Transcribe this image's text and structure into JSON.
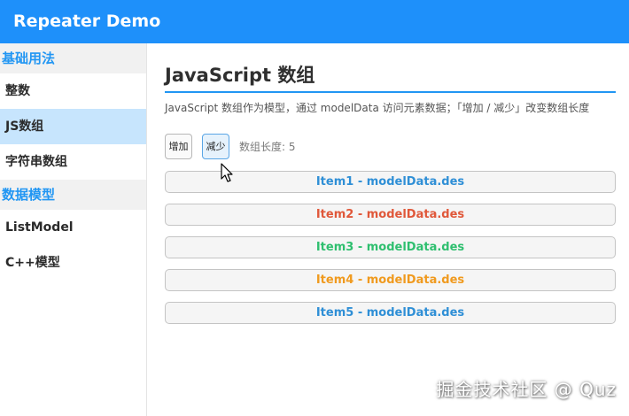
{
  "app": {
    "title": "Repeater Demo"
  },
  "sidebar": {
    "groups": [
      {
        "header": "基础用法",
        "items": [
          "整数",
          "JS数组",
          "字符串数组"
        ]
      },
      {
        "header": "数据模型",
        "items": [
          "ListModel",
          "C++模型"
        ]
      }
    ]
  },
  "main": {
    "title": "JavaScript 数组",
    "description": "JavaScript 数组作为模型，通过 modelData 访问元素数据；「增加 / 减少」改变数组长度",
    "add_label": "增加",
    "remove_label": "减少",
    "count_label": "数组长度: 5",
    "items": [
      {
        "label": "Item1 - modelData.des",
        "color": "#2f8fd6"
      },
      {
        "label": "Item2 - modelData.des",
        "color": "#e0583a"
      },
      {
        "label": "Item3 - modelData.des",
        "color": "#2fbf6f"
      },
      {
        "label": "Item4 - modelData.des",
        "color": "#f09a1e"
      },
      {
        "label": "Item5 - modelData.des",
        "color": "#2f8fd6"
      }
    ]
  },
  "colors": {
    "accent": "#1e90fa",
    "active_nav": "#c7e5fd",
    "group_header_text": "#2196f3"
  },
  "watermark": "掘金技术社区 @ Quz"
}
